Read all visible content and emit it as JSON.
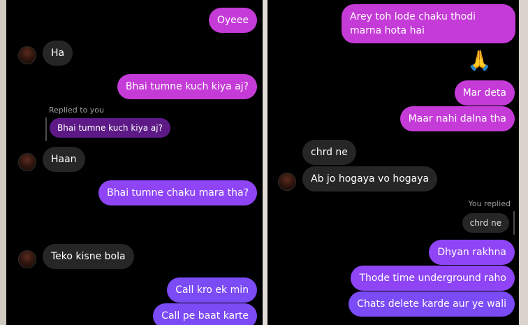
{
  "left_chat": {
    "messages": [
      {
        "text": "Oyeee"
      },
      {
        "text": "Ha"
      },
      {
        "text": "Bhai tumne kuch kiya aj?"
      },
      {
        "text": "Replied to you"
      },
      {
        "text": "Bhai tumne kuch kiya aj?"
      },
      {
        "text": "Haan"
      },
      {
        "text": "Bhai tumne chaku mara tha?"
      },
      {
        "text": "😭"
      },
      {
        "text": "Teko kisne bola"
      },
      {
        "text": "Call kro ek min"
      },
      {
        "text": "Call pe baat karte"
      }
    ]
  },
  "right_chat": {
    "messages": [
      {
        "text": "Arey toh lode chaku thodi marna hota hai"
      },
      {
        "text": "🙏😭"
      },
      {
        "text": "Mar deta"
      },
      {
        "text": "Maar nahi dalna tha"
      },
      {
        "text": "chrd ne"
      },
      {
        "text": "Ab jo hogaya vo hogaya"
      },
      {
        "text": "You replied"
      },
      {
        "text": "chrd ne"
      },
      {
        "text": "Dhyan rakhna"
      },
      {
        "text": "Thode time underground raho"
      },
      {
        "text": "Chats delete karde aur ye wali"
      }
    ]
  },
  "colors": {
    "outgoing_pink": "#c53bd8",
    "outgoing_purple": "#9b3cff",
    "outgoing_violet": "#8f45f6",
    "incoming": "#262626",
    "background": "#000000"
  }
}
